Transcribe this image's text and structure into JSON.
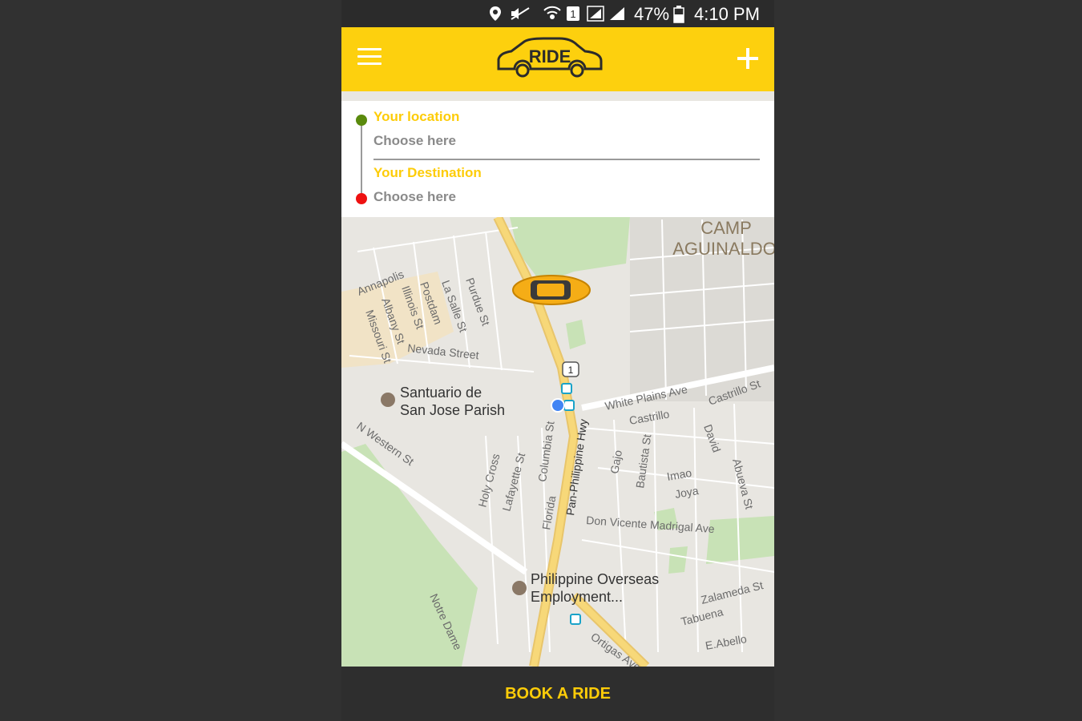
{
  "status_bar": {
    "battery": "47%",
    "time": "4:10 PM",
    "icons": [
      "location-icon",
      "mute-icon",
      "wifi-icon",
      "sim-icon",
      "signal-icon",
      "signal-icon",
      "battery-icon"
    ]
  },
  "app_bar": {
    "logo_text": "RIDE",
    "menu_icon": "hamburger-icon",
    "add_icon": "plus-icon"
  },
  "location_card": {
    "origin_label": "Your location",
    "origin_value": "Choose here",
    "destination_label": "Your Destination",
    "destination_value": "Choose here"
  },
  "map": {
    "labels": {
      "camp_1": "CAMP",
      "camp_2": "AGUINALDO",
      "annapolis": "Annapolis",
      "illinois": "Illinois St",
      "postdam": "Postdam",
      "lasalle": "La Salle St",
      "purdue": "Purdue St",
      "albany": "Albany St",
      "missouri": "Missouri St",
      "nevada": "Nevada Street",
      "santuario_1": "Santuario de",
      "santuario_2": "San Jose Parish",
      "n_western": "N Western St",
      "white_plains": "White Plains Ave",
      "castrillo_st": "Castrillo St",
      "castrillo": "Castrillo",
      "david": "David",
      "holy_cross": "Holy Cross",
      "lafayette": "Lafayette St",
      "columbia": "Columbia St",
      "pan_phil": "Pan-Philippine Hwy",
      "gajo": "Gajo",
      "bautista": "Bautista St",
      "imao": "Imao",
      "joya": "Joya",
      "abueva": "Abueva St",
      "florida": "Florida",
      "don_vicente": "Don Vicente Madrigal Ave",
      "poea_1": "Philippine Overseas",
      "poea_2": "Employment...",
      "notre_dame": "Notre Dame",
      "zalameda": "Zalameda St",
      "tabuena": "Tabuena",
      "e_abello": "E.Abello",
      "ortigas": "Ortigas Ave",
      "route_number": "1"
    }
  },
  "footer": {
    "book_label": "BOOK A RIDE"
  },
  "colors": {
    "accent": "#fdd00e",
    "label_yellow": "#fdcc08",
    "dark": "#2e2e2e",
    "origin_dot": "#5a8a0d",
    "destination_dot": "#ee1111",
    "my_location": "#4285f4"
  }
}
